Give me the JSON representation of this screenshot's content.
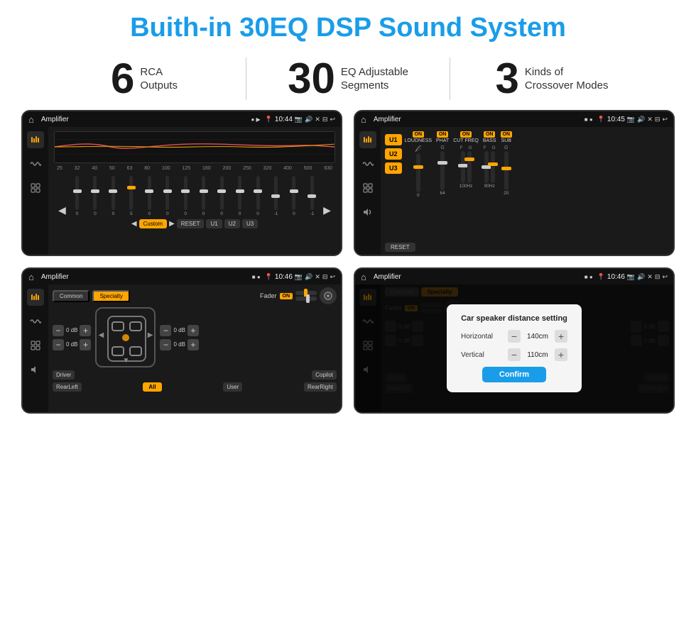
{
  "page": {
    "title": "Buith-in 30EQ DSP Sound System",
    "title_color": "#1a9de8"
  },
  "stats": [
    {
      "number": "6",
      "label": "RCA\nOutputs"
    },
    {
      "number": "30",
      "label": "EQ Adjustable\nSegments"
    },
    {
      "number": "3",
      "label": "Kinds of\nCrossover Modes"
    }
  ],
  "screens": [
    {
      "id": "screen1",
      "title": "Amplifier",
      "time": "10:44",
      "type": "eq"
    },
    {
      "id": "screen2",
      "title": "Amplifier",
      "time": "10:45",
      "type": "crossover"
    },
    {
      "id": "screen3",
      "title": "Amplifier",
      "time": "10:46",
      "type": "fader"
    },
    {
      "id": "screen4",
      "title": "Amplifier",
      "time": "10:46",
      "type": "dialog"
    }
  ],
  "eq_screen": {
    "frequencies": [
      "25",
      "32",
      "40",
      "50",
      "63",
      "80",
      "100",
      "125",
      "160",
      "200",
      "250",
      "320",
      "400",
      "500",
      "630"
    ],
    "values": [
      "0",
      "0",
      "0",
      "5",
      "0",
      "0",
      "0",
      "0",
      "0",
      "0",
      "0",
      "-1",
      "0",
      "-1"
    ],
    "presets": [
      "Custom",
      "RESET",
      "U1",
      "U2",
      "U3"
    ]
  },
  "crossover_screen": {
    "presets": [
      "U1",
      "U2",
      "U3"
    ],
    "channels": [
      "LOUDNESS",
      "PHAT",
      "CUT FREQ",
      "BASS",
      "SUB"
    ],
    "reset_label": "RESET"
  },
  "fader_screen": {
    "tabs": [
      "Common",
      "Specialty"
    ],
    "fader_label": "Fader",
    "fader_on": "ON",
    "volume_rows": [
      {
        "label": "0 dB"
      },
      {
        "label": "0 dB"
      },
      {
        "label": "0 dB"
      },
      {
        "label": "0 dB"
      }
    ],
    "buttons": [
      "Driver",
      "Copilot",
      "RearLeft",
      "All",
      "User",
      "RearRight"
    ]
  },
  "dialog_screen": {
    "tabs": [
      "Common",
      "Specialty"
    ],
    "dialog_title": "Car speaker distance setting",
    "horizontal_label": "Horizontal",
    "horizontal_value": "140cm",
    "vertical_label": "Vertical",
    "vertical_value": "110cm",
    "confirm_label": "Confirm",
    "db_value1": "0 dB",
    "db_value2": "0 dB",
    "buttons": [
      "Driver",
      "Copilot",
      "RearLeft",
      "All",
      "User",
      "RearRight"
    ]
  },
  "icons": {
    "home": "⌂",
    "back": "↩",
    "settings": "⚙",
    "location": "📍",
    "speaker": "🔊",
    "eq": "≋",
    "waveform": "∿",
    "balance": "⊞"
  }
}
